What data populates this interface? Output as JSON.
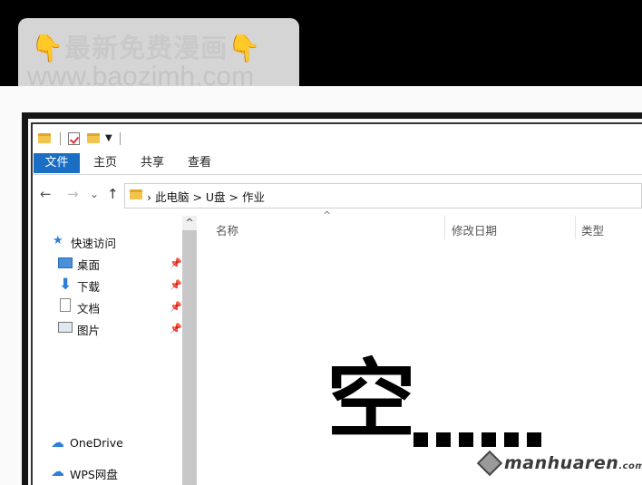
{
  "watermark": {
    "line1_text": "最新免费漫画",
    "hand_icon": "👇",
    "line2_text": "www.baozimh.com"
  },
  "ribbon": {
    "tab_file": "文件",
    "tab_home": "主页",
    "tab_share": "共享",
    "tab_view": "查看"
  },
  "nav": {
    "back": "←",
    "forward": "→",
    "dropdown": "⌄",
    "up": "↑",
    "path": "› 此电脑 > U盘 > 作业"
  },
  "sidebar": {
    "quick_access": "快速访问",
    "items": [
      {
        "label": "桌面",
        "icon": "desktop-icon",
        "pinned": true
      },
      {
        "label": "下载",
        "icon": "download-icon",
        "pinned": true
      },
      {
        "label": "文档",
        "icon": "document-icon",
        "pinned": true
      },
      {
        "label": "图片",
        "icon": "pictures-icon",
        "pinned": true
      }
    ],
    "onedrive": "OneDrive",
    "wps": "WPS网盘"
  },
  "content": {
    "col_name": "名称",
    "col_date": "修改日期",
    "col_type": "类型",
    "empty_text": "空"
  },
  "site_mark": {
    "main": "manhuaren",
    "suffix": ".com"
  },
  "colors": {
    "file_tab": "#1a6ec4",
    "folder": "#f3c44d",
    "accent_blue": "#2f7fd6"
  }
}
